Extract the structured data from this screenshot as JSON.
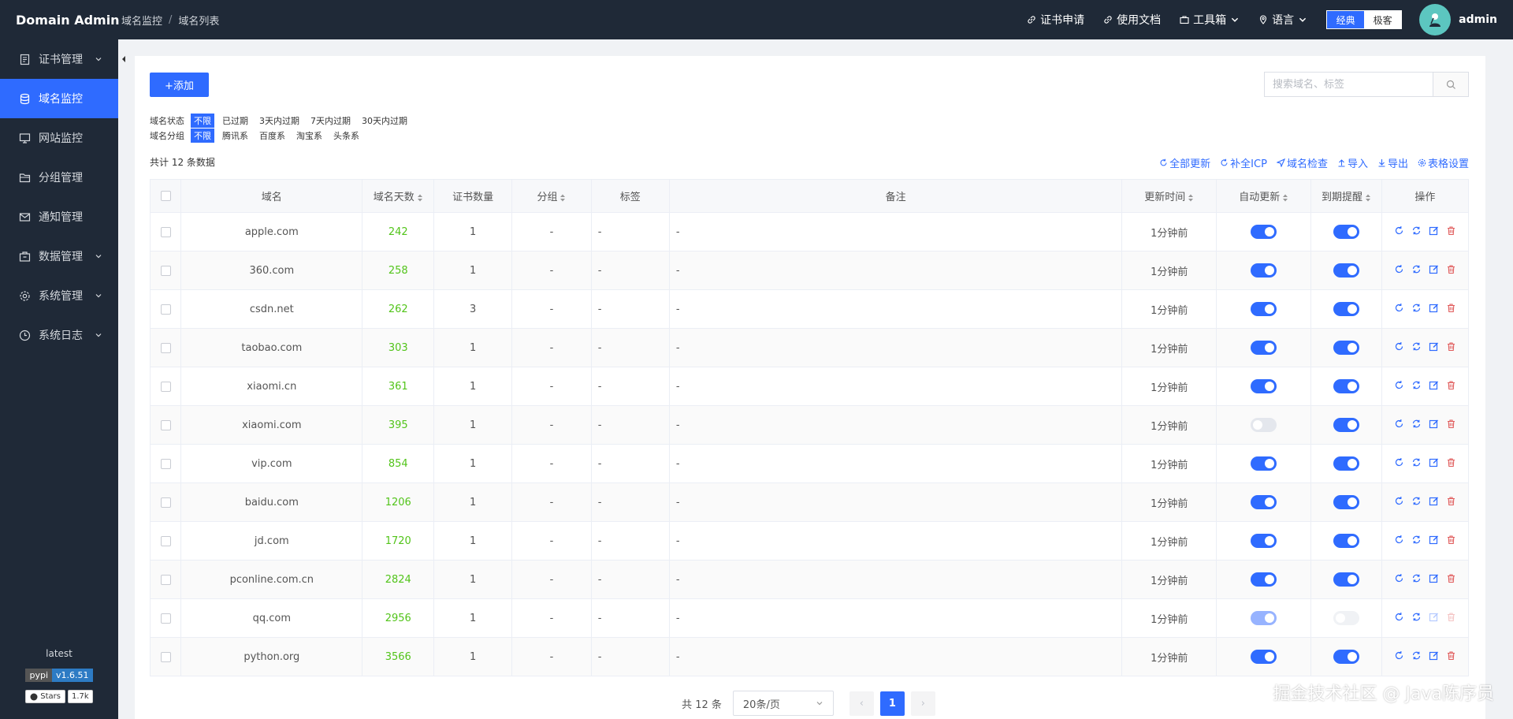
{
  "header": {
    "brand": "Domain Admin",
    "breadcrumb": [
      "域名监控",
      "域名列表"
    ],
    "links": {
      "cert_apply": "证书申请",
      "docs": "使用文档",
      "toolbox": "工具箱",
      "language": "语言"
    },
    "theme": {
      "classic": "经典",
      "geek": "极客"
    },
    "username": "admin"
  },
  "sidebar": {
    "items": [
      {
        "label": "证书管理",
        "icon": "file-icon",
        "has_children": true
      },
      {
        "label": "域名监控",
        "icon": "database-icon",
        "active": true
      },
      {
        "label": "网站监控",
        "icon": "monitor-icon"
      },
      {
        "label": "分组管理",
        "icon": "folder-icon"
      },
      {
        "label": "通知管理",
        "icon": "mail-icon"
      },
      {
        "label": "数据管理",
        "icon": "box-icon",
        "has_children": true
      },
      {
        "label": "系统管理",
        "icon": "gear-icon",
        "has_children": true
      },
      {
        "label": "系统日志",
        "icon": "clock-icon",
        "has_children": true
      }
    ],
    "footer": {
      "version_label": "latest",
      "pypi_left": "pypi",
      "pypi_right": "v1.6.51",
      "stars_left": "Stars",
      "stars_right": "1.7k"
    }
  },
  "toolbar": {
    "add_label": "+添加",
    "search_placeholder": "搜索域名、标签"
  },
  "filters": {
    "status": {
      "label": "域名状态",
      "options": [
        "不限",
        "已过期",
        "3天内过期",
        "7天内过期",
        "30天内过期"
      ]
    },
    "group": {
      "label": "域名分组",
      "options": [
        "不限",
        "腾讯系",
        "百度系",
        "淘宝系",
        "头条系"
      ]
    }
  },
  "summary": "共计 12 条数据",
  "tools": [
    "全部更新",
    "补全ICP",
    "域名检查",
    "导入",
    "导出",
    "表格设置"
  ],
  "table": {
    "headers": {
      "domain": "域名",
      "days": "域名天数",
      "certs": "证书数量",
      "group": "分组",
      "tags": "标签",
      "remark": "备注",
      "updated": "更新时间",
      "auto_update": "自动更新",
      "expire_alert": "到期提醒",
      "ops": "操作"
    },
    "rows": [
      {
        "domain": "apple.com",
        "days": "242",
        "certs": "1",
        "group": "-",
        "tags": "-",
        "remark": "-",
        "updated": "1分钟前",
        "auto": true,
        "alert": true
      },
      {
        "domain": "360.com",
        "days": "258",
        "certs": "1",
        "group": "-",
        "tags": "-",
        "remark": "-",
        "updated": "1分钟前",
        "auto": true,
        "alert": true
      },
      {
        "domain": "csdn.net",
        "days": "262",
        "certs": "3",
        "group": "-",
        "tags": "-",
        "remark": "-",
        "updated": "1分钟前",
        "auto": true,
        "alert": true
      },
      {
        "domain": "taobao.com",
        "days": "303",
        "certs": "1",
        "group": "-",
        "tags": "-",
        "remark": "-",
        "updated": "1分钟前",
        "auto": true,
        "alert": true
      },
      {
        "domain": "xiaomi.cn",
        "days": "361",
        "certs": "1",
        "group": "-",
        "tags": "-",
        "remark": "-",
        "updated": "1分钟前",
        "auto": true,
        "alert": true
      },
      {
        "domain": "xiaomi.com",
        "days": "395",
        "certs": "1",
        "group": "-",
        "tags": "-",
        "remark": "-",
        "updated": "1分钟前",
        "auto": false,
        "alert": true
      },
      {
        "domain": "vip.com",
        "days": "854",
        "certs": "1",
        "group": "-",
        "tags": "-",
        "remark": "-",
        "updated": "1分钟前",
        "auto": true,
        "alert": true
      },
      {
        "domain": "baidu.com",
        "days": "1206",
        "certs": "1",
        "group": "-",
        "tags": "-",
        "remark": "-",
        "updated": "1分钟前",
        "auto": true,
        "alert": true
      },
      {
        "domain": "jd.com",
        "days": "1720",
        "certs": "1",
        "group": "-",
        "tags": "-",
        "remark": "-",
        "updated": "1分钟前",
        "auto": true,
        "alert": true
      },
      {
        "domain": "pconline.com.cn",
        "days": "2824",
        "certs": "1",
        "group": "-",
        "tags": "-",
        "remark": "-",
        "updated": "1分钟前",
        "auto": true,
        "alert": true
      },
      {
        "domain": "qq.com",
        "days": "2956",
        "certs": "1",
        "group": "-",
        "tags": "-",
        "remark": "-",
        "updated": "1分钟前",
        "auto": "dim",
        "alert": "dimoff",
        "faded": true
      },
      {
        "domain": "python.org",
        "days": "3566",
        "certs": "1",
        "group": "-",
        "tags": "-",
        "remark": "-",
        "updated": "1分钟前",
        "auto": true,
        "alert": true
      }
    ]
  },
  "pagination": {
    "total": "共 12 条",
    "page_size": "20条/页",
    "current": "1",
    "prev": "‹",
    "next": "›"
  },
  "watermark": "掘金技术社区 @ Java陈序员",
  "colors": {
    "primary": "#2f6bff",
    "sidebar": "#1f2937",
    "days": "#52c41a",
    "danger": "#e05a5a"
  }
}
